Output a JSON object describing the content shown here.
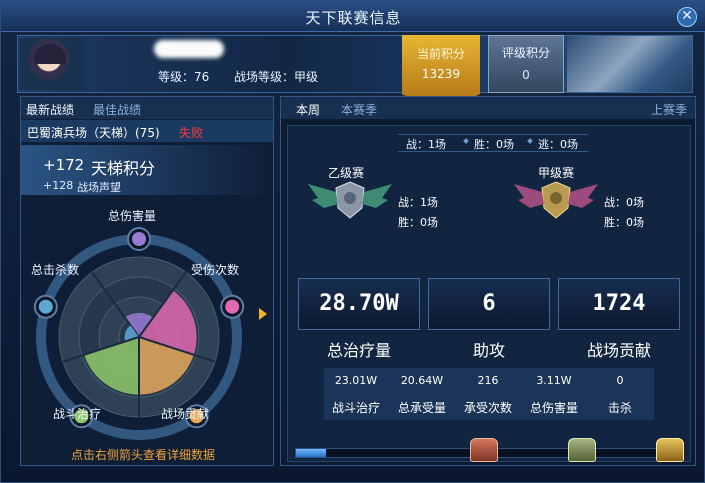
{
  "window": {
    "title": "天下联赛信息",
    "close_label": "✕"
  },
  "player": {
    "level_label": "等级：",
    "level": "76",
    "bf_label": "战场等级：",
    "bf_level": "甲级"
  },
  "scores": {
    "current_label": "当前积分",
    "current_value": "13239",
    "rank_label": "评级积分",
    "rank_value": "0"
  },
  "left_tabs": [
    "最新战绩",
    "最佳战绩"
  ],
  "battle": {
    "name": "巴蜀演兵场（天梯）(75)",
    "result": "失败"
  },
  "gains": {
    "ladder_value": "+172",
    "ladder_label": "天梯积分",
    "prestige_value": "+128",
    "prestige_label": "战场声望"
  },
  "radar": {
    "labels": [
      "总伤害量",
      "受伤次数",
      "战场贡献",
      "战斗治疗",
      "总击杀数"
    ],
    "levels": [
      0.3,
      0.72,
      0.72,
      0.72,
      0.18
    ],
    "slice_colors": [
      "#9a7bd6",
      "#e06ab0",
      "#e7a95a",
      "#90c96a",
      "#5fa8d6"
    ]
  },
  "hint": "点击右侧箭头查看详细数据",
  "right_tabs": [
    "本周",
    "本赛季",
    "上赛季"
  ],
  "summary": {
    "battles": "战：1场",
    "wins": "胜：0场",
    "escapes": "逃：0场"
  },
  "tiers": [
    {
      "title": "乙级赛",
      "battles": "战：1场",
      "wins": "胜：0场"
    },
    {
      "title": "甲级赛",
      "battles": "战：0场",
      "wins": "胜：0场"
    }
  ],
  "big_stats": [
    {
      "value": "28.70W",
      "label": "总治疗量"
    },
    {
      "value": "6",
      "label": "助攻"
    },
    {
      "value": "1724",
      "label": "战场贡献"
    }
  ],
  "details": [
    {
      "value": "23.01W",
      "label": "战斗治疗"
    },
    {
      "value": "20.64W",
      "label": "总承受量"
    },
    {
      "value": "216",
      "label": "承受次数"
    },
    {
      "value": "3.11W",
      "label": "总伤害量"
    },
    {
      "value": "0",
      "label": "击杀"
    }
  ],
  "progress": 0.08,
  "colors": {
    "accent_gold": "#e8b533",
    "loss_red": "#ff3b3b",
    "hint_orange": "#f0a33a"
  }
}
